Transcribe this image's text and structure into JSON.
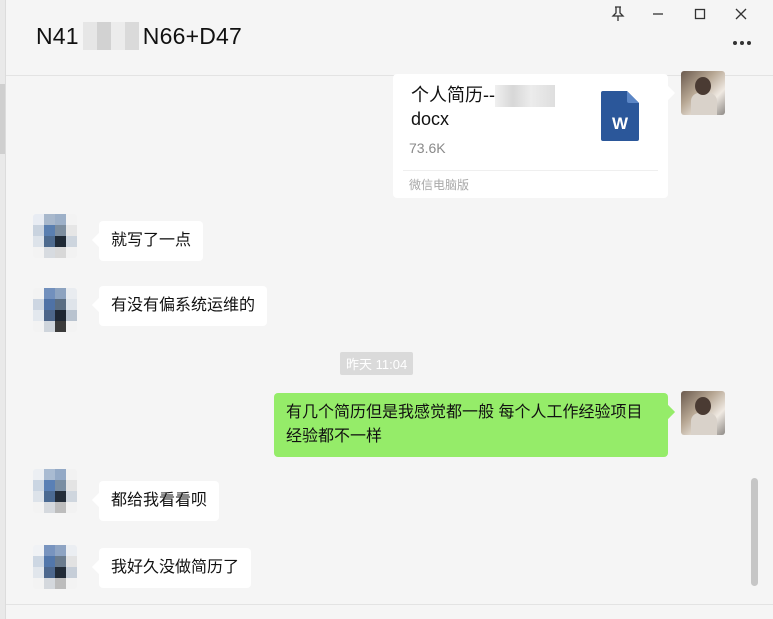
{
  "window": {
    "title_prefix": "N41",
    "title_suffix": "N66+D47",
    "controls": {
      "pin": "pin-icon",
      "minimize": "minimize-icon",
      "maximize": "maximize-icon",
      "close": "close-icon",
      "more": "more-icon"
    }
  },
  "colors": {
    "bubble_self": "#95ec69",
    "bubble_other": "#ffffff",
    "background": "#f5f5f5",
    "word_blue": "#2b579a"
  },
  "messages": [
    {
      "sender": "me",
      "type": "file",
      "file_name": "个人简历--",
      "file_ext": "docx",
      "file_size": "73.6K",
      "source": "微信电脑版",
      "icon": "word-file-icon"
    },
    {
      "sender": "other",
      "type": "text",
      "text": "就写了一点"
    },
    {
      "sender": "other",
      "type": "text",
      "text": "有没有偏系统运维的"
    },
    {
      "type": "timestamp",
      "text": "昨天 11:04"
    },
    {
      "sender": "me",
      "type": "text",
      "text": "有几个简历但是我感觉都一般 每个人工作经验项目经验都不一样"
    },
    {
      "sender": "other",
      "type": "text",
      "text": "都给我看看呗"
    },
    {
      "sender": "other",
      "type": "text",
      "text": "我好久没做简历了"
    }
  ]
}
